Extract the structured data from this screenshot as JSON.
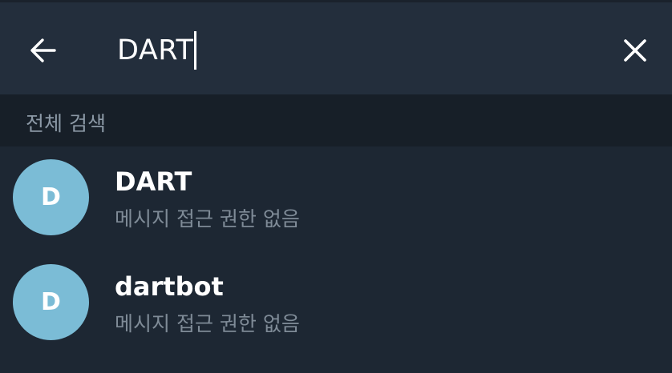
{
  "search": {
    "query": "DART"
  },
  "icons": {
    "back": "arrow-left",
    "clear": "close-x"
  },
  "section": {
    "title": "전체 검색"
  },
  "results": [
    {
      "avatar_letter": "D",
      "name": "DART",
      "status": "메시지 접근 권한 없음"
    },
    {
      "avatar_letter": "D",
      "name": "dartbot",
      "status": "메시지 접근 권한 없음"
    }
  ],
  "colors": {
    "header_bg": "#232e3c",
    "body_bg": "#1d2733",
    "section_bg": "#171f28",
    "avatar_bg": "#7bbcd6",
    "secondary_text": "#7f8b97"
  }
}
